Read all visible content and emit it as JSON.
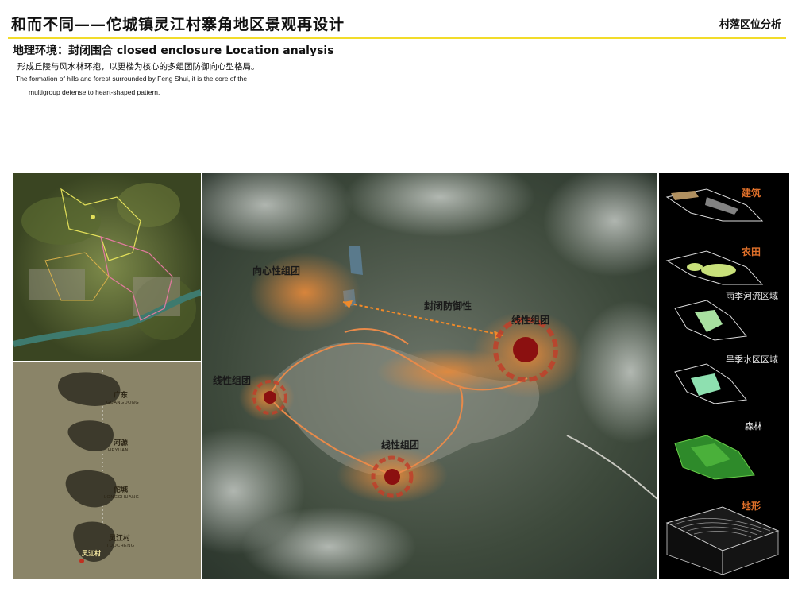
{
  "header": {
    "title": "和而不同——佗城镇灵江村寨角地区景观再设计",
    "section_tag": "村落区位分析"
  },
  "intro": {
    "subhead": "地理环境：封闭围合 closed enclosure Location analysis",
    "desc_cn": "形成丘陵与风水林环抱，以更楼为核心的多组团防御向心型格局。",
    "desc_en_line1": "The formation of hills and forest surrounded by Feng Shui, it is the core of the",
    "desc_en_line2": "multigroup defense to heart-shaped pattern."
  },
  "locator": {
    "items": [
      {
        "cn": "广东",
        "en": "GUANGDONG"
      },
      {
        "cn": "河源",
        "en": "HEYUAN"
      },
      {
        "cn": "佗城",
        "en": "LONGCHUANG"
      },
      {
        "cn": "灵江村",
        "en": "TUOCHENG"
      }
    ],
    "marker_label": "灵江村"
  },
  "main_map": {
    "labels": {
      "centripetal": "向心性组团",
      "closed_defense": "封闭防御性",
      "linear_east": "线性组团",
      "linear_west": "线性组团",
      "linear_south": "线性组团"
    },
    "colors": {
      "accent": "#e0702a",
      "node": "#8b1010"
    }
  },
  "layers": {
    "items": [
      {
        "label": "建筑",
        "style": "orange"
      },
      {
        "label": "农田",
        "style": "orange"
      },
      {
        "label": "雨季河流区域",
        "style": "white"
      },
      {
        "label": "旱季水区区域",
        "style": "white"
      },
      {
        "label": "森林",
        "style": "white"
      },
      {
        "label": "地形",
        "style": "orange"
      }
    ]
  }
}
